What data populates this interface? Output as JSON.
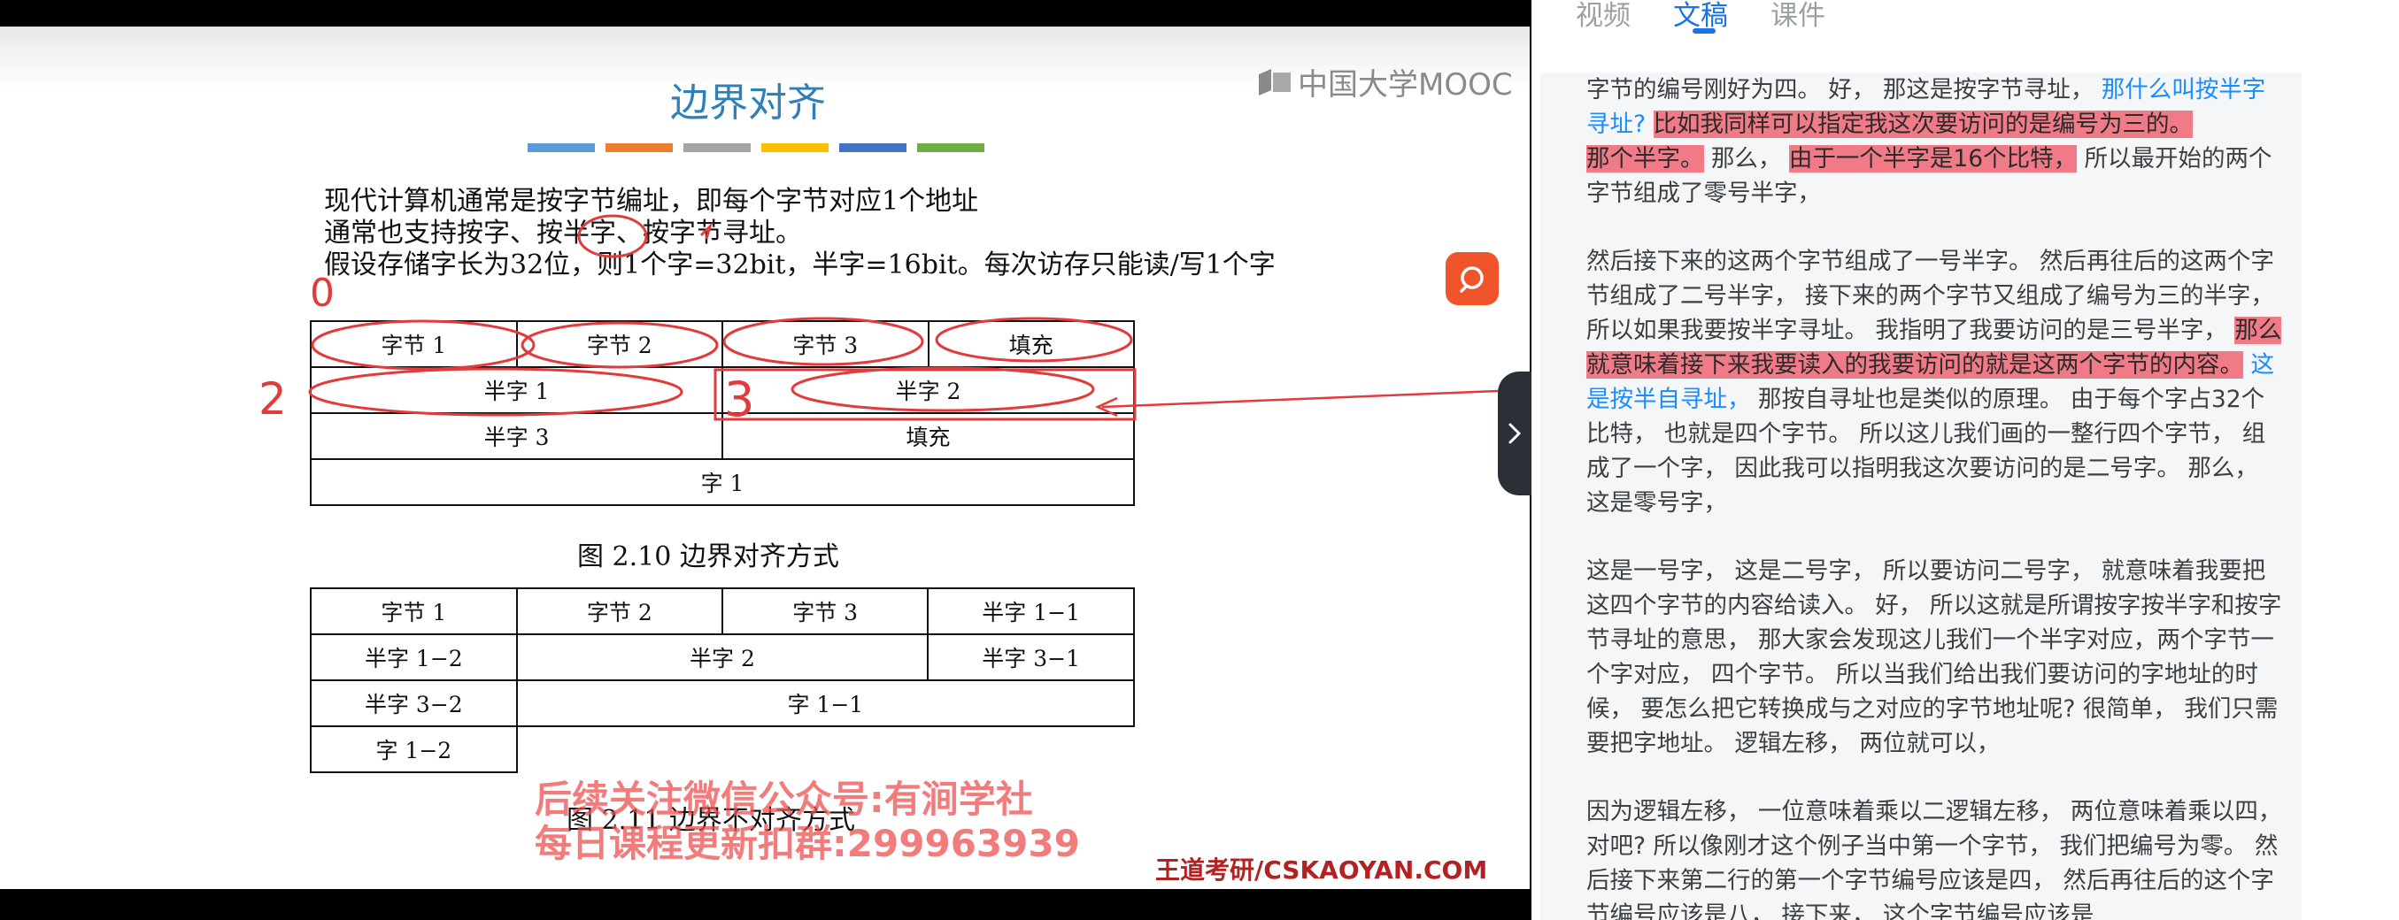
{
  "slide": {
    "title": "边界对齐",
    "logo_text": "中国大学MOOC",
    "lines": [
      "现代计算机通常是按字节编址，即每个字节对应1个地址",
      "通常也支持按字、按半字、按字节寻址。",
      "假设存储字长为32位，则1个字=32bit，半字=16bit。每次访存只能读/写1个字"
    ],
    "color_bar": [
      "#5b9bd5",
      "#ed7d31",
      "#a5a5a5",
      "#ffc000",
      "#4472c4",
      "#70ad47"
    ],
    "table1": [
      [
        "字节 1",
        "字节 2",
        "字节 3",
        "填充"
      ],
      [
        "半字 1",
        "半字 2"
      ],
      [
        "半字 3",
        "填充"
      ],
      [
        "字 1"
      ]
    ],
    "fig1_caption": "图 2.10   边界对齐方式",
    "table2": [
      [
        "字节 1",
        "字节 2",
        "字节 3",
        "半字 1−1"
      ],
      [
        "半字 1−2",
        "半字 2",
        "半字 3−1"
      ],
      [
        "半字 3−2",
        "字 1−1"
      ],
      [
        "字 1−2"
      ]
    ],
    "fig2_caption": "图 2.11   边界不对齐方式",
    "watermark_line1": "后续关注微信公众号:有涧学社",
    "watermark_line2": "每日课程更新扣群:299963939",
    "brand": "王道考研/CSKAOYAN.COM",
    "annotations": [
      "0",
      "2",
      "3"
    ]
  },
  "side_panel": {
    "tabs": [
      "视频",
      "文稿",
      "课件"
    ],
    "active_tab": "文稿"
  },
  "transcript": {
    "p1": {
      "a": "字节的编号刚好为四。 好， 那这是按字节寻址， ",
      "b": "那什么叫按半字寻址?",
      "c": " ",
      "d": "比如我同样可以指定我这次要访问的是编号为三的。",
      "e": "那个半字。",
      "f": " 那么， ",
      "g": "由于一个半字是16个比特，",
      "h": " 所以最开始的两个字节组成了零号半字，"
    },
    "p2": {
      "a": "然后接下来的这两个字节组成了一号半字。 然后再往后的这两个字节组成了二号半字， 接下来的两个字节又组成了编号为三的半字， 所以如果我要按半字寻址。 我指明了我要访问的是三号半字， ",
      "b": "那么就意味着接下来我要读入的我要访问的就是这两个字节的内容。",
      "c": " ",
      "d": "这是按半自寻址，",
      "e": " 那按自寻址也是类似的原理。 由于每个字占32个比特， 也就是四个字节。 所以这儿我们画的一整行四个字节， 组成了一个字， 因此我可以指明我这次要访问的是二号字。 那么， 这是零号字，"
    },
    "p3": "这是一号字， 这是二号字， 所以要访问二号字， 就意味着我要把这四个字节的内容给读入。 好， 所以这就是所谓按字按半字和按字节寻址的意思， 那大家会发现这儿我们一个半字对应，两个字节一个字对应， 四个字节。 所以当我们给出我们要访问的字地址的时候， 要怎么把它转换成与之对应的字节地址呢? 很简单， 我们只需要把字地址。 逻辑左移， 两位就可以，",
    "p4": "因为逻辑左移， 一位意味着乘以二逻辑左移， 两位意味着乘以四， 对吧? 所以像刚才这个例子当中第一个字节， 我们把编号为零。 然后接下来第二行的第一个字节编号应该是四， 然后再往后的这个字节编号应该是八， 接下来， 这个字节编号应该是"
  }
}
